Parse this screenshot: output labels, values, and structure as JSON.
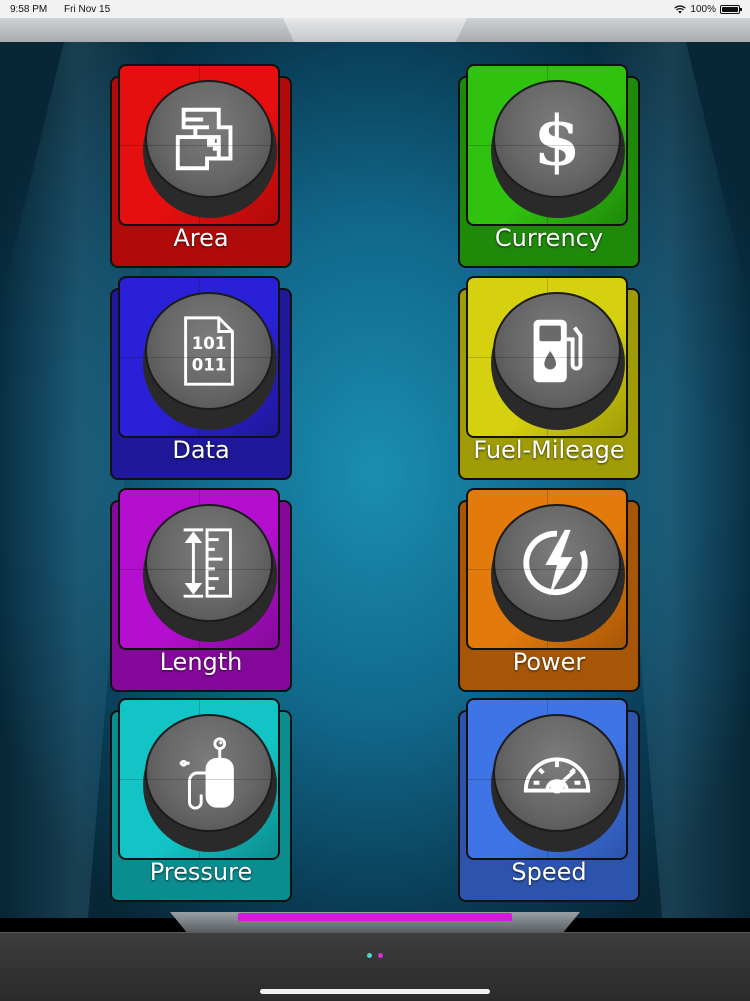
{
  "status_bar": {
    "time": "9:58 PM",
    "date": "Fri Nov 15",
    "battery": "100%",
    "battery_level": 1.0
  },
  "tiles": [
    {
      "label": "Area",
      "icon": "floor-plan-icon",
      "color": "#e60f0f",
      "dark": "#b00a0a"
    },
    {
      "label": "Currency",
      "icon": "dollar-icon",
      "color": "#2fc20f",
      "dark": "#1f8a0a"
    },
    {
      "label": "Data",
      "icon": "binary-file-icon",
      "color": "#2a20d8",
      "dark": "#1f1898"
    },
    {
      "label": "Fuel-Mileage",
      "icon": "fuel-pump-icon",
      "color": "#d6d10e",
      "dark": "#a09c08"
    },
    {
      "label": "Length",
      "icon": "ruler-icon",
      "color": "#b40fcf",
      "dark": "#84099a"
    },
    {
      "label": "Power",
      "icon": "lightning-icon",
      "color": "#e27a0c",
      "dark": "#a65606"
    },
    {
      "label": "Pressure",
      "icon": "gas-tank-icon",
      "color": "#12c4c6",
      "dark": "#0b8c8e"
    },
    {
      "label": "Speed",
      "icon": "speedometer-icon",
      "color": "#3f74e6",
      "dark": "#2c54ad"
    }
  ],
  "page_dots": [
    {
      "color": "#4fd6c8",
      "active": false
    },
    {
      "color": "#d630d6",
      "active": true
    }
  ]
}
